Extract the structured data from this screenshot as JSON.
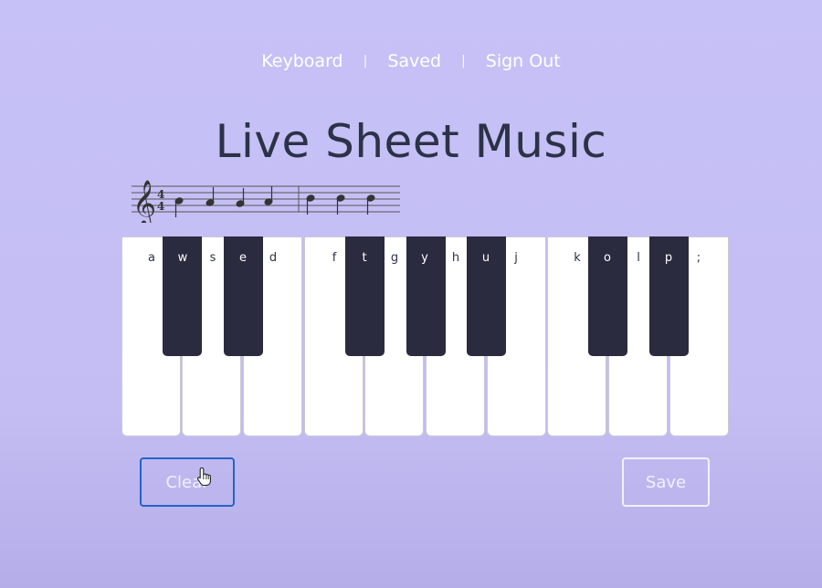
{
  "nav": {
    "keyboard": "Keyboard",
    "separator": "|",
    "saved": "Saved",
    "sign_out": "Sign Out"
  },
  "title": "Live Sheet Music",
  "piano": {
    "white_keys": [
      "a",
      "s",
      "d",
      "f",
      "g",
      "h",
      "j",
      "k",
      "l",
      ";"
    ],
    "black_keys": [
      "w",
      "e",
      "t",
      "y",
      "u",
      "o",
      "p"
    ]
  },
  "buttons": {
    "clear": "Clear",
    "save": "Save"
  },
  "staff": {
    "time_signature": [
      "4",
      "4"
    ]
  },
  "colors": {
    "background": "#c6c1f6",
    "title": "#2c3247",
    "black_key": "#2b2b3f",
    "clear_border": "#2563c9"
  },
  "icons": [
    "treble-clef-icon",
    "hand-pointer-icon"
  ]
}
